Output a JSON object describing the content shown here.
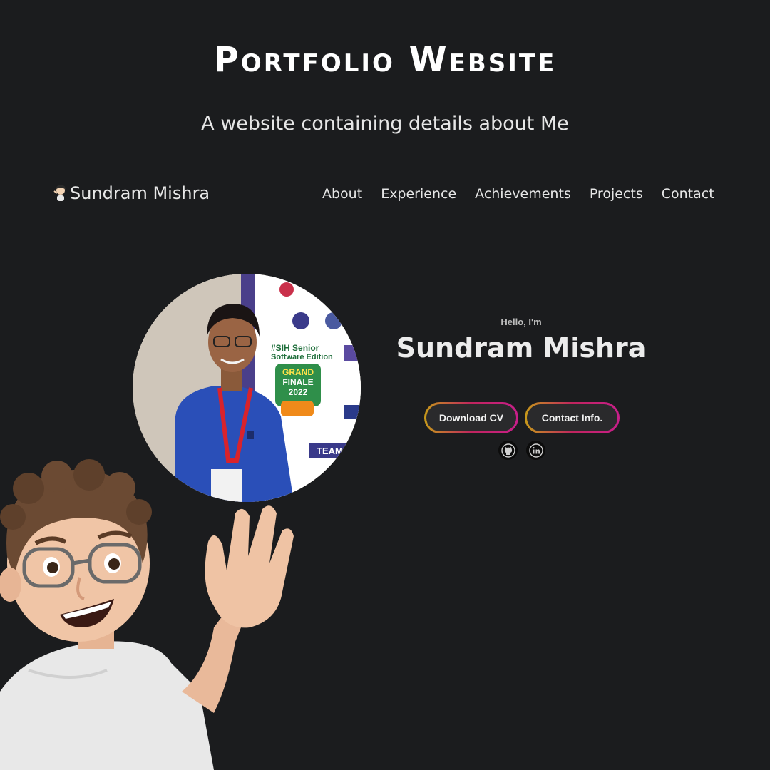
{
  "promo": {
    "title": "Portfolio Website",
    "subtitle": "A website containing details about Me"
  },
  "navbar": {
    "brand_name": "Sundram Mishra",
    "brand_icon": "person-emoji-icon",
    "links": [
      "About",
      "Experience",
      "Achievements",
      "Projects",
      "Contact"
    ]
  },
  "hero": {
    "greeting": "Hello, I'm",
    "name": "Sundram Mishra",
    "buttons": {
      "download_cv": "Download CV",
      "contact_info": "Contact Info."
    },
    "social_icons": [
      "github-icon",
      "linkedin-icon"
    ],
    "photo_poster_text": [
      "#SIH Senior",
      "Software Edition",
      "GRAND",
      "FINALE",
      "2022",
      "TEAM"
    ]
  },
  "colors": {
    "background": "#1b1c1e",
    "button_gradient": [
      "#c79a1a",
      "#c0245e",
      "#c81f8a"
    ],
    "shirt_blue": "#2a4fb8"
  }
}
